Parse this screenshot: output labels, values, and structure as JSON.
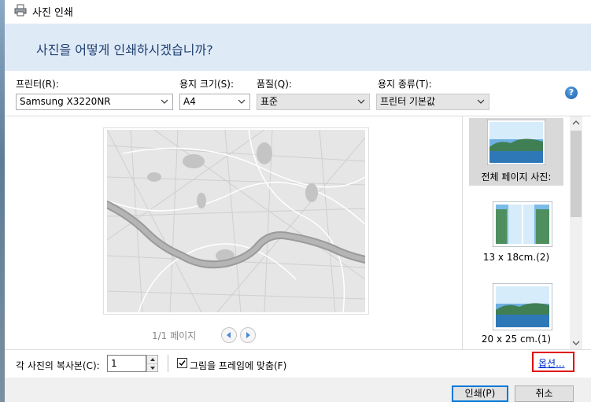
{
  "window": {
    "title": "사진 인쇄"
  },
  "header": {
    "question": "사진을 어떻게 인쇄하시겠습니까?"
  },
  "fields": {
    "printer": {
      "label": "프린터(R):",
      "value": "Samsung X3220NR"
    },
    "paper_size": {
      "label": "용지 크기(S):",
      "value": "A4"
    },
    "quality": {
      "label": "품질(Q):",
      "value": "표준"
    },
    "paper_type": {
      "label": "용지 종류(T):",
      "value": "프린터 기본값"
    }
  },
  "help": {
    "glyph": "?"
  },
  "preview": {
    "page_label": "1/1 페이지"
  },
  "layouts": [
    {
      "caption": "전체 페이지 사진:",
      "selected": true
    },
    {
      "caption": "13 x 18cm.(2)",
      "selected": false
    },
    {
      "caption": "20 x 25 cm.(1)",
      "selected": false
    }
  ],
  "copies": {
    "label": "각 사진의 복사본(C):",
    "value": "1"
  },
  "fit": {
    "label": "그림을 프레임에 맞춤(F)",
    "checked": true
  },
  "options": {
    "label": "옵션..."
  },
  "buttons": {
    "print": "인쇄(P)",
    "cancel": "취소"
  },
  "colors": {
    "header_bg": "#dfeaf7",
    "header_text": "#1e3f6f",
    "highlight": "#e00000",
    "link": "#0033cc"
  }
}
